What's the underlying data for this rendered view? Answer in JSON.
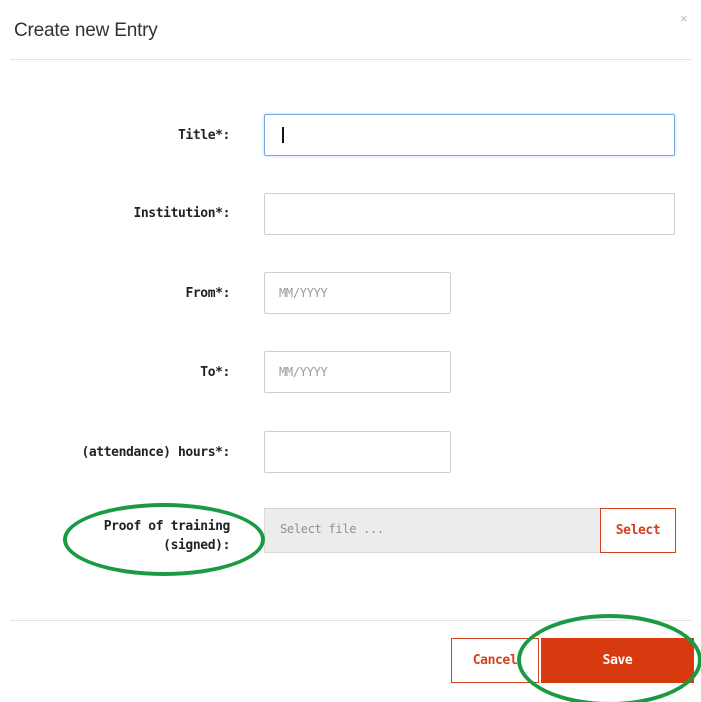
{
  "dialog": {
    "title": "Create new Entry",
    "close_label": "×"
  },
  "form": {
    "title": {
      "label": "Title*:",
      "value": ""
    },
    "institution": {
      "label": "Institution*:",
      "value": ""
    },
    "from": {
      "label": "From*:",
      "placeholder": "MM/YYYY",
      "value": ""
    },
    "to": {
      "label": "To*:",
      "placeholder": "MM/YYYY",
      "value": ""
    },
    "hours": {
      "label": "(attendance) hours*:",
      "value": ""
    },
    "proof": {
      "label_line1": "Proof of training",
      "label_line2": "(signed):",
      "file_placeholder": "Select file ...",
      "select_label": "Select"
    }
  },
  "footer": {
    "cancel_label": "Cancel",
    "save_label": "Save"
  },
  "colors": {
    "accent": "#d83a10",
    "annotation": "#1a9a43",
    "focus_border": "#74a8e0"
  }
}
